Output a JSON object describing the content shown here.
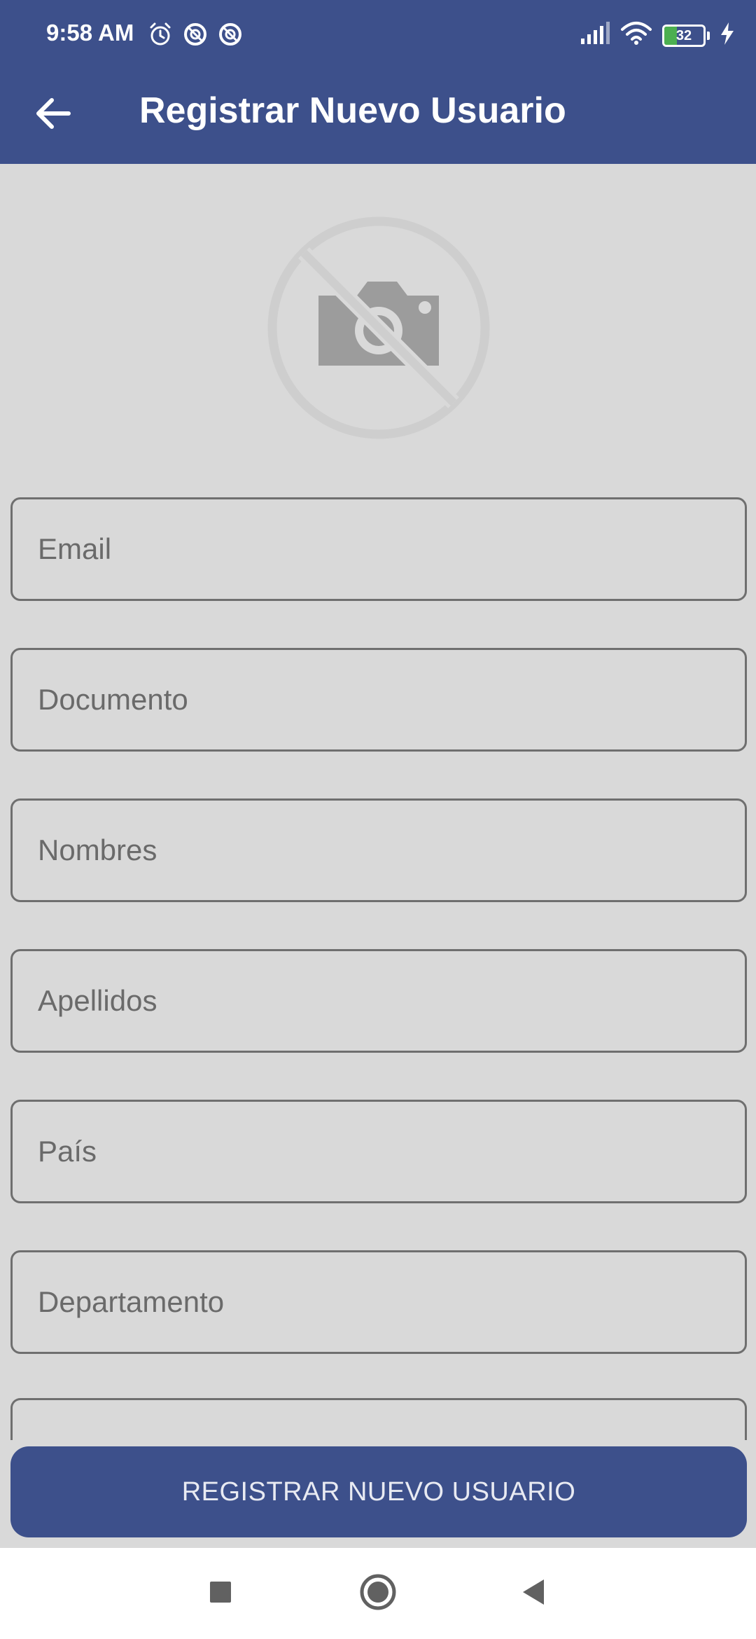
{
  "status_bar": {
    "time": "9:58 AM",
    "battery_level": "32",
    "battery_fraction": 0.32,
    "icons": [
      "alarm-icon",
      "dnd-icon",
      "dnd-icon",
      "signal-icon",
      "wifi-icon",
      "battery-icon",
      "charging-icon"
    ]
  },
  "app_bar": {
    "title": "Registrar Nuevo Usuario",
    "back_icon": "arrow-left-icon"
  },
  "photo": {
    "icon": "no-photo-icon"
  },
  "form": {
    "fields": [
      {
        "placeholder": "Email",
        "value": ""
      },
      {
        "placeholder": "Documento",
        "value": ""
      },
      {
        "placeholder": "Nombres",
        "value": ""
      },
      {
        "placeholder": "Apellidos",
        "value": ""
      },
      {
        "placeholder": "País",
        "value": ""
      },
      {
        "placeholder": "Departamento",
        "value": ""
      }
    ]
  },
  "register_button": {
    "label": "REGISTRAR NUEVO USUARIO"
  },
  "nav_bar": {
    "icons": [
      "recents-icon",
      "home-icon",
      "back-icon"
    ]
  },
  "colors": {
    "primary": "#3d508b",
    "background": "#d9d9d9",
    "field_border": "#6f6f6f",
    "placeholder": "#6a6a6a",
    "battery_fill": "#4caf50"
  }
}
